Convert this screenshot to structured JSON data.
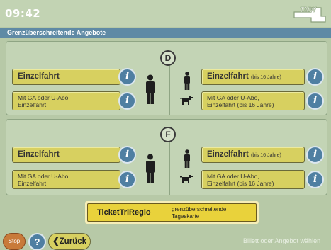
{
  "clock": "09:42",
  "logo_text": "TNW",
  "header_title": "Grenzüberschreitende Angebote",
  "sections": [
    {
      "country": "D",
      "left": {
        "main_label": "Einzelfahrt",
        "sub_label_1": "Mit GA oder U-Abo,",
        "sub_label_2": "Einzelfahrt"
      },
      "right": {
        "main_label": "Einzelfahrt",
        "main_note": "(bis 16 Jahre)",
        "sub_label_1": "Mit GA oder U-Abo,",
        "sub_label_2": "Einzelfahrt (bis 16 Jahre)"
      }
    },
    {
      "country": "F",
      "left": {
        "main_label": "Einzelfahrt",
        "sub_label_1": "Mit GA oder U-Abo,",
        "sub_label_2": "Einzelfahrt"
      },
      "right": {
        "main_label": "Einzelfahrt",
        "main_note": "(bis 16 Jahre)",
        "sub_label_1": "Mit GA oder U-Abo,",
        "sub_label_2": "Einzelfahrt (bis 16 Jahre)"
      }
    }
  ],
  "info_glyph": "i",
  "ticket": {
    "name": "TicketTriRegio",
    "desc_1": "grenzüberschreitende",
    "desc_2": "Tageskarte"
  },
  "footer": {
    "stop_label": "Stop",
    "help_label": "?",
    "back_label": "Zurück",
    "hint": "Billett oder Angebot wählen"
  },
  "icons": {
    "adult": "person-icon",
    "child": "child-icon",
    "dog": "dog-icon",
    "info": "info-icon",
    "back_arrow": "chevron-left-icon"
  },
  "colors": {
    "background": "#b7c9a7",
    "header_bar": "#5f8aa5",
    "button": "#d7d060",
    "info": "#4f7fa2",
    "ticket": "#e9d23b",
    "stop": "#c87a3a"
  }
}
